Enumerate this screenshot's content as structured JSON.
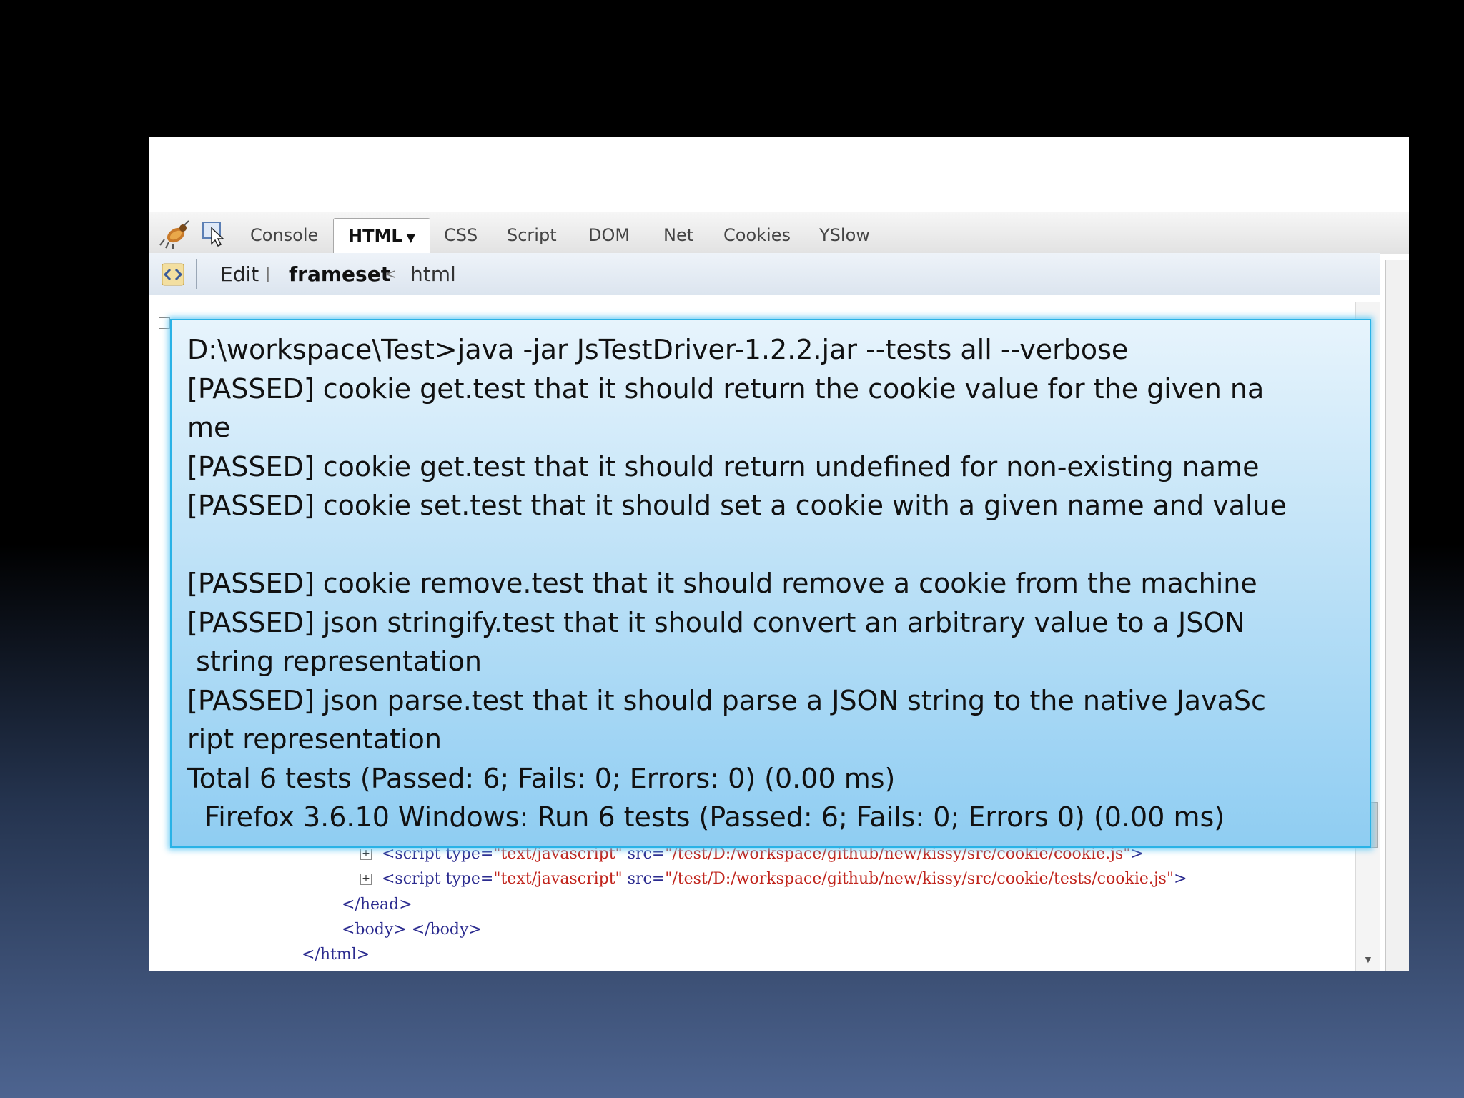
{
  "firebug": {
    "tabs": [
      "Console",
      "HTML",
      "CSS",
      "Script",
      "DOM",
      "Net",
      "Cookies",
      "YSlow"
    ],
    "active_tab": "HTML",
    "breadcrumb": {
      "edit_label": "Edit",
      "current": "frameset",
      "separator": "<",
      "parent": "html"
    },
    "tree": {
      "script1": {
        "tag_open": "<script",
        "attr_type": "type=",
        "type_value": "\"text/javascript\"",
        "attr_src": "src=",
        "src_value": "\"/test/D:/workspace/github/new/kissy/src/cookie/cookie.js\"",
        "tag_close": ">"
      },
      "script2": {
        "tag_open": "<script",
        "attr_type": "type=",
        "type_value": "\"text/javascript\"",
        "attr_src": "src=",
        "src_value": "\"/test/D:/workspace/github/new/kissy/src/cookie/tests/cookie.js\"",
        "tag_close": ">"
      },
      "head_close": "</head>",
      "body_line": "<body> </body>",
      "html_close": "</html>"
    }
  },
  "console_output": {
    "lines": [
      "D:\\workspace\\Test>java -jar JsTestDriver-1.2.2.jar --tests all --verbose",
      "[PASSED] cookie get.test that it should return the cookie value for the given na",
      "me",
      "[PASSED] cookie get.test that it should return undefined for non-existing name",
      "[PASSED] cookie set.test that it should set a cookie with a given name and value",
      "",
      "[PASSED] cookie remove.test that it should remove a cookie from the machine",
      "[PASSED] json stringify.test that it should convert an arbitrary value to a JSON",
      " string representation",
      "[PASSED] json parse.test that it should parse a JSON string to the native JavaSc",
      "ript representation",
      "Total 6 tests (Passed: 6; Fails: 0; Errors: 0) (0.00 ms)",
      "  Firefox 3.6.10 Windows: Run 6 tests (Passed: 6; Fails: 0; Errors 0) (0.00 ms)"
    ]
  },
  "colors": {
    "overlay_border": "#29b2e6",
    "tag_color": "#2b2b8f",
    "value_color": "#c0241c"
  }
}
